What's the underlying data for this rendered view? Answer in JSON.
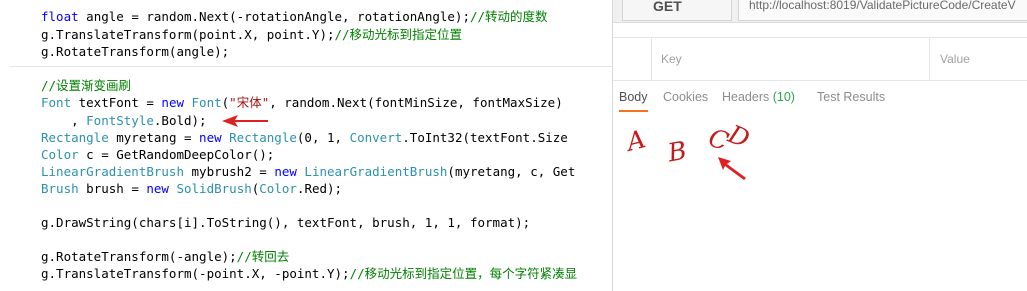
{
  "editor": {
    "lines": [
      {
        "segments": [
          {
            "t": "float",
            "c": "kw"
          },
          {
            "t": " angle = random.Next(-rotationAngle, rotationAngle);"
          },
          {
            "t": "//转动的度数",
            "c": "cm"
          }
        ]
      },
      {
        "segments": [
          {
            "t": "g.TranslateTransform(point.X, point.Y);"
          },
          {
            "t": "//移动光标到指定位置",
            "c": "cm"
          }
        ]
      },
      {
        "segments": [
          {
            "t": "g.RotateTransform(angle);"
          }
        ]
      },
      {
        "segments": [
          {
            "t": "//设置渐变画刷",
            "c": "cm"
          }
        ]
      },
      {
        "segments": [
          {
            "t": "Font",
            "c": "ty"
          },
          {
            "t": " textFont = "
          },
          {
            "t": "new",
            "c": "kw"
          },
          {
            "t": " "
          },
          {
            "t": "Font",
            "c": "ty"
          },
          {
            "t": "("
          },
          {
            "t": "\"宋体\"",
            "c": "st"
          },
          {
            "t": ", random.Next(fontMinSize, fontMaxSize)"
          }
        ]
      },
      {
        "segments": [
          {
            "t": "    , "
          },
          {
            "t": "FontStyle",
            "c": "ty"
          },
          {
            "t": ".Bold);"
          }
        ]
      },
      {
        "segments": [
          {
            "t": "Rectangle",
            "c": "ty"
          },
          {
            "t": " myretang = "
          },
          {
            "t": "new",
            "c": "kw"
          },
          {
            "t": " "
          },
          {
            "t": "Rectangle",
            "c": "ty"
          },
          {
            "t": "(0, 1, "
          },
          {
            "t": "Convert",
            "c": "ty"
          },
          {
            "t": ".ToInt32(textFont.Size"
          }
        ]
      },
      {
        "segments": [
          {
            "t": "Color",
            "c": "ty"
          },
          {
            "t": " c = GetRandomDeepColor();"
          }
        ]
      },
      {
        "segments": [
          {
            "t": "LinearGradientBrush",
            "c": "ty"
          },
          {
            "t": " mybrush2 = "
          },
          {
            "t": "new",
            "c": "kw"
          },
          {
            "t": " "
          },
          {
            "t": "LinearGradientBrush",
            "c": "ty"
          },
          {
            "t": "(myretang, c, Get"
          }
        ]
      },
      {
        "segments": [
          {
            "t": "Brush",
            "c": "ty"
          },
          {
            "t": " brush = "
          },
          {
            "t": "new",
            "c": "kw"
          },
          {
            "t": " "
          },
          {
            "t": "SolidBrush",
            "c": "ty"
          },
          {
            "t": "("
          },
          {
            "t": "Color",
            "c": "ty"
          },
          {
            "t": ".Red);"
          }
        ]
      },
      {
        "segments": [
          {
            "t": "g.DrawString(chars[i].ToString(), textFont, brush, 1, 1, format);"
          }
        ]
      },
      {
        "segments": [
          {
            "t": "g.RotateTransform(-angle);"
          },
          {
            "t": "//转回去",
            "c": "cm"
          }
        ]
      },
      {
        "segments": [
          {
            "t": "g.TranslateTransform(-point.X, -point.Y);"
          },
          {
            "t": "//移动光标到指定位置，每个字符紧凑显",
            "c": "cm"
          }
        ]
      }
    ]
  },
  "postman": {
    "method": "GET",
    "url": "http://localhost:8019/ValidatePictureCode/CreateV",
    "params": {
      "key_placeholder": "Key",
      "value_placeholder": "Value"
    },
    "tabs": [
      {
        "label": "Body",
        "active": true
      },
      {
        "label": "Cookies",
        "active": false
      },
      {
        "label": "Headers",
        "count": "(10)",
        "active": false
      },
      {
        "label": "Test Results",
        "active": false
      }
    ],
    "captcha": {
      "chars": [
        "A",
        "B",
        "C",
        "D"
      ],
      "color": "#c41a1a"
    }
  },
  "accent_color": "#f47023",
  "annotation_color": "#e02020"
}
